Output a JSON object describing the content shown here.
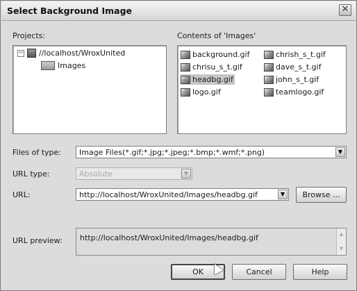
{
  "dialog": {
    "title": "Select Background Image"
  },
  "projects": {
    "label": "Projects:",
    "root": "//localhost/WroxUnited",
    "expander": "−",
    "child": "Images"
  },
  "contents": {
    "label": "Contents of 'Images'",
    "files": [
      "background.gif",
      "chrisu_s_t.gif",
      "headbg.gif",
      "logo.gif",
      "chrish_s_t.gif",
      "dave_s_t.gif",
      "john_s_t.gif",
      "teamlogo.gif"
    ],
    "selected": "headbg.gif"
  },
  "files_of_type": {
    "label": "Files of type:",
    "value": "Image Files(*.gif;*.jpg;*.jpeg;*.bmp;*.wmf;*.png)"
  },
  "url_type": {
    "label": "URL type:",
    "value": "Absolute"
  },
  "url": {
    "label": "URL:",
    "value": "http://localhost/WroxUnited/Images/headbg.gif",
    "browse_label": "Browse ..."
  },
  "url_preview": {
    "label": "URL preview:",
    "value": "http://localhost/WroxUnited/Images/headbg.gif"
  },
  "buttons": {
    "ok": "OK",
    "cancel": "Cancel",
    "help": "Help"
  },
  "icons": {
    "close": "close-icon",
    "dropdown": "chevron-down-icon",
    "file": "gif-file-icon",
    "folder": "folder-icon",
    "server": "server-icon"
  }
}
